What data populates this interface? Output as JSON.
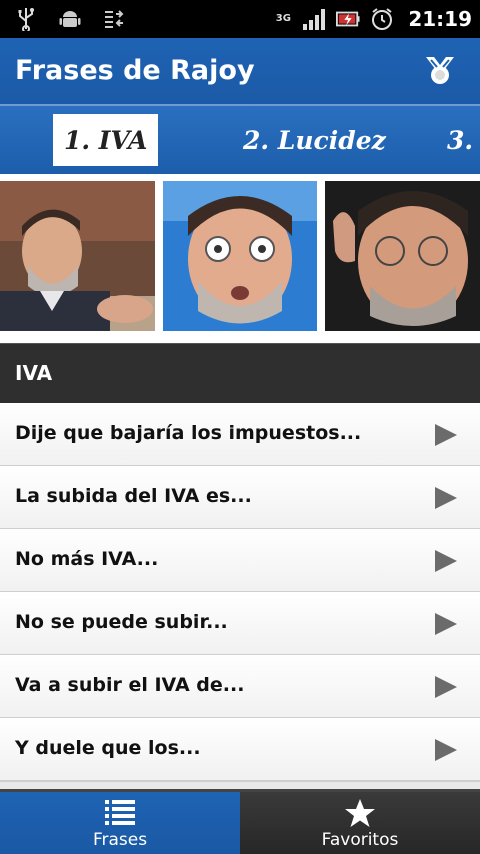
{
  "status_bar": {
    "network": "3G",
    "time": "21:19"
  },
  "action_bar": {
    "title": "Frases de Rajoy"
  },
  "tabs": [
    {
      "label": "1. IVA"
    },
    {
      "label": "2. Lucidez"
    },
    {
      "label": "3. ..."
    }
  ],
  "section": {
    "title": "IVA"
  },
  "phrases": [
    {
      "label": "Dije que bajaría los impuestos..."
    },
    {
      "label": "La subida del IVA es..."
    },
    {
      "label": "No más IVA..."
    },
    {
      "label": "No se puede subir..."
    },
    {
      "label": "Va a subir el IVA de..."
    },
    {
      "label": "Y duele que los..."
    }
  ],
  "bottom_tabs": [
    {
      "label": "Frases",
      "icon": "list-icon"
    },
    {
      "label": "Favoritos",
      "icon": "star-icon"
    }
  ],
  "colors": {
    "brand_blue": "#1f63b4",
    "section_bg": "#2f2f2f"
  }
}
